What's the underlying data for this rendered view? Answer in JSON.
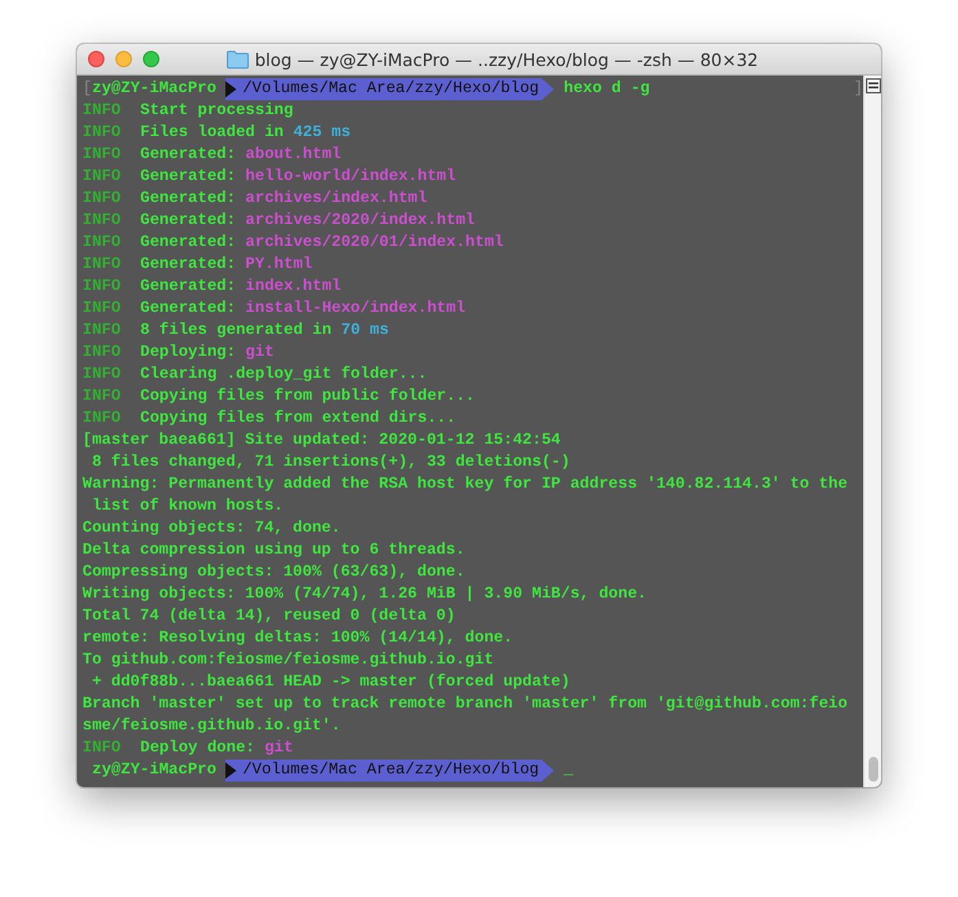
{
  "window": {
    "title": "blog — zy@ZY-iMacPro — ..zzy/Hexo/blog — -zsh — 80×32"
  },
  "lines": [
    {
      "kind": "prompt",
      "open_mark": "[",
      "user": "zy@ZY-iMacPro",
      "path": "/Volumes/Mac Area/zzy/Hexo/blog",
      "command": "hexo d -g",
      "close_mark": "]"
    },
    {
      "kind": "log",
      "level": "INFO",
      "parts": [
        {
          "text": "Start processing",
          "kind": "green"
        }
      ]
    },
    {
      "kind": "log",
      "level": "INFO",
      "parts": [
        {
          "text": "Files loaded in ",
          "kind": "green"
        },
        {
          "text": "425 ms",
          "kind": "cyan"
        }
      ]
    },
    {
      "kind": "log",
      "level": "INFO",
      "parts": [
        {
          "text": "Generated: ",
          "kind": "green"
        },
        {
          "text": "about.html",
          "kind": "magenta"
        }
      ]
    },
    {
      "kind": "log",
      "level": "INFO",
      "parts": [
        {
          "text": "Generated: ",
          "kind": "green"
        },
        {
          "text": "hello-world/index.html",
          "kind": "magenta"
        }
      ]
    },
    {
      "kind": "log",
      "level": "INFO",
      "parts": [
        {
          "text": "Generated: ",
          "kind": "green"
        },
        {
          "text": "archives/index.html",
          "kind": "magenta"
        }
      ]
    },
    {
      "kind": "log",
      "level": "INFO",
      "parts": [
        {
          "text": "Generated: ",
          "kind": "green"
        },
        {
          "text": "archives/2020/index.html",
          "kind": "magenta"
        }
      ]
    },
    {
      "kind": "log",
      "level": "INFO",
      "parts": [
        {
          "text": "Generated: ",
          "kind": "green"
        },
        {
          "text": "archives/2020/01/index.html",
          "kind": "magenta"
        }
      ]
    },
    {
      "kind": "log",
      "level": "INFO",
      "parts": [
        {
          "text": "Generated: ",
          "kind": "green"
        },
        {
          "text": "PY.html",
          "kind": "magenta"
        }
      ]
    },
    {
      "kind": "log",
      "level": "INFO",
      "parts": [
        {
          "text": "Generated: ",
          "kind": "green"
        },
        {
          "text": "index.html",
          "kind": "magenta"
        }
      ]
    },
    {
      "kind": "log",
      "level": "INFO",
      "parts": [
        {
          "text": "Generated: ",
          "kind": "green"
        },
        {
          "text": "install-Hexo/index.html",
          "kind": "magenta"
        }
      ]
    },
    {
      "kind": "log",
      "level": "INFO",
      "parts": [
        {
          "text": "8 files generated in ",
          "kind": "green"
        },
        {
          "text": "70 ms",
          "kind": "cyan"
        }
      ]
    },
    {
      "kind": "log",
      "level": "INFO",
      "parts": [
        {
          "text": "Deploying: ",
          "kind": "green"
        },
        {
          "text": "git",
          "kind": "magenta"
        }
      ]
    },
    {
      "kind": "log",
      "level": "INFO",
      "parts": [
        {
          "text": "Clearing .deploy_git folder...",
          "kind": "green"
        }
      ]
    },
    {
      "kind": "log",
      "level": "INFO",
      "parts": [
        {
          "text": "Copying files from public folder...",
          "kind": "green"
        }
      ]
    },
    {
      "kind": "log",
      "level": "INFO",
      "parts": [
        {
          "text": "Copying files from extend dirs...",
          "kind": "green"
        }
      ]
    },
    {
      "kind": "text",
      "text": "[master baea661] Site updated: 2020-01-12 15:42:54"
    },
    {
      "kind": "text",
      "text": " 8 files changed, 71 insertions(+), 33 deletions(-)"
    },
    {
      "kind": "text",
      "text": "Warning: Permanently added the RSA host key for IP address '140.82.114.3' to the"
    },
    {
      "kind": "text",
      "text": " list of known hosts."
    },
    {
      "kind": "text",
      "text": "Counting objects: 74, done."
    },
    {
      "kind": "text",
      "text": "Delta compression using up to 6 threads."
    },
    {
      "kind": "text",
      "text": "Compressing objects: 100% (63/63), done."
    },
    {
      "kind": "text",
      "text": "Writing objects: 100% (74/74), 1.26 MiB | 3.90 MiB/s, done."
    },
    {
      "kind": "text",
      "text": "Total 74 (delta 14), reused 0 (delta 0)"
    },
    {
      "kind": "text",
      "text": "remote: Resolving deltas: 100% (14/14), done."
    },
    {
      "kind": "text",
      "text": "To github.com:feiosme/feiosme.github.io.git"
    },
    {
      "kind": "text",
      "text": " + dd0f88b...baea661 HEAD -> master (forced update)"
    },
    {
      "kind": "text",
      "text": "Branch 'master' set up to track remote branch 'master' from 'git@github.com:feio"
    },
    {
      "kind": "text",
      "text": "sme/feiosme.github.io.git'."
    },
    {
      "kind": "log",
      "level": "INFO",
      "parts": [
        {
          "text": "Deploy done: ",
          "kind": "green"
        },
        {
          "text": "git",
          "kind": "magenta"
        }
      ]
    },
    {
      "kind": "prompt",
      "user": "zy@ZY-iMacPro",
      "path": "/Volumes/Mac Area/zzy/Hexo/blog",
      "cursor": "_"
    }
  ]
}
